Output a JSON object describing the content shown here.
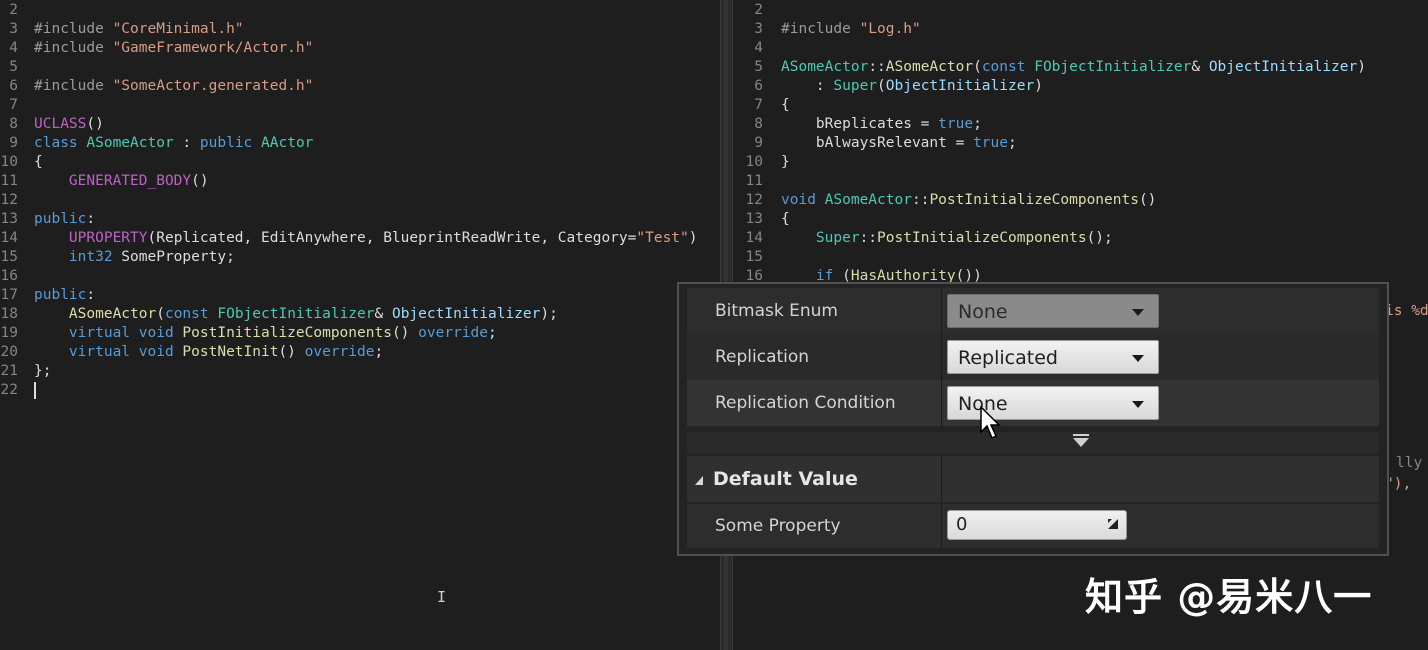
{
  "left_editor": {
    "lines": [
      {
        "n": "2",
        "html": ""
      },
      {
        "n": "3",
        "html": "<span class='pp'>#include</span> <span class='str'>\"CoreMinimal.h\"</span>"
      },
      {
        "n": "4",
        "html": "<span class='pp'>#include</span> <span class='str'>\"GameFramework/Actor.h\"</span>"
      },
      {
        "n": "5",
        "html": ""
      },
      {
        "n": "6",
        "html": "<span class='pp'>#include</span> <span class='str'>\"SomeActor.generated.h\"</span>"
      },
      {
        "n": "7",
        "html": ""
      },
      {
        "n": "8",
        "html": "<span class='mac'>UCLASS</span>()"
      },
      {
        "n": "9",
        "html": "<span class='kw'>class</span> <span class='ty'>ASomeActor</span> : <span class='kw'>public</span> <span class='ty'>AActor</span>"
      },
      {
        "n": "10",
        "html": "{"
      },
      {
        "n": "11",
        "html": "    <span class='mac'>GENERATED_BODY</span>()"
      },
      {
        "n": "12",
        "html": ""
      },
      {
        "n": "13",
        "html": "<span class='kw'>public</span>:"
      },
      {
        "n": "14",
        "html": "    <span class='mac'>UPROPERTY</span>(Replicated, EditAnywhere, BlueprintReadWrite, Category=<span class='str'>\"Test\"</span>)"
      },
      {
        "n": "15",
        "html": "    <span class='kw'>int32</span> SomeProperty;"
      },
      {
        "n": "16",
        "html": ""
      },
      {
        "n": "17",
        "html": "<span class='kw'>public</span>:"
      },
      {
        "n": "18",
        "html": "    <span class='fn'>ASomeActor</span>(<span class='kw'>const</span> <span class='ty'>FObjectInitializer</span>&amp; <span class='prm'>ObjectInitializer</span>);"
      },
      {
        "n": "19",
        "html": "    <span class='kw'>virtual</span> <span class='kw'>void</span> <span class='fn'>PostInitializeComponents</span>() <span class='kw'>override</span>;"
      },
      {
        "n": "20",
        "html": "    <span class='kw'>virtual</span> <span class='kw'>void</span> <span class='fn'>PostNetInit</span>() <span class='kw'>override</span>;"
      },
      {
        "n": "21",
        "html": "};"
      },
      {
        "n": "22",
        "html": "<span class='caret'></span>"
      }
    ]
  },
  "right_editor": {
    "lines": [
      {
        "n": "2",
        "html": ""
      },
      {
        "n": "3",
        "html": "<span class='pp'>#include</span> <span class='str'>\"Log.h\"</span>"
      },
      {
        "n": "4",
        "html": ""
      },
      {
        "n": "5",
        "html": "<span class='ty'>ASomeActor</span>::<span class='fn'>ASomeActor</span>(<span class='kw'>const</span> <span class='ty'>FObjectInitializer</span>&amp; <span class='prm'>ObjectInitializer</span>)"
      },
      {
        "n": "6",
        "html": "    : <span class='ty'>Super</span>(<span class='prm'>ObjectInitializer</span>)"
      },
      {
        "n": "7",
        "html": "{"
      },
      {
        "n": "8",
        "html": "    bReplicates = <span class='tru'>true</span>;"
      },
      {
        "n": "9",
        "html": "    bAlwaysRelevant = <span class='tru'>true</span>;"
      },
      {
        "n": "10",
        "html": "}"
      },
      {
        "n": "11",
        "html": ""
      },
      {
        "n": "12",
        "html": "<span class='kw'>void</span> <span class='ty'>ASomeActor</span>::<span class='fn'>PostInitializeComponents</span>()"
      },
      {
        "n": "13",
        "html": "{"
      },
      {
        "n": "14",
        "html": "    <span class='ty'>Super</span>::<span class='fn'>PostInitializeComponents</span>();"
      },
      {
        "n": "15",
        "html": ""
      },
      {
        "n": "16",
        "html": "    <span class='kw'>if</span> (<span class='fn'>HasAuthority</span>())"
      }
    ],
    "peek_1": "is %d",
    "peek_2": "lly",
    "peek_3": "\"),"
  },
  "details": {
    "rows": [
      {
        "label": "Bitmask Enum",
        "value": "None"
      },
      {
        "label": "Replication",
        "value": "Replicated"
      },
      {
        "label": "Replication Condition",
        "value": "None"
      }
    ],
    "category_title": "Default Value",
    "some_property_label": "Some Property",
    "some_property_value": "0"
  },
  "watermark": "知乎 @易米八一",
  "colors": {
    "background": "#1e1e1e",
    "keyword": "#569cd6",
    "string": "#d69d85",
    "type": "#4ec9b0"
  }
}
